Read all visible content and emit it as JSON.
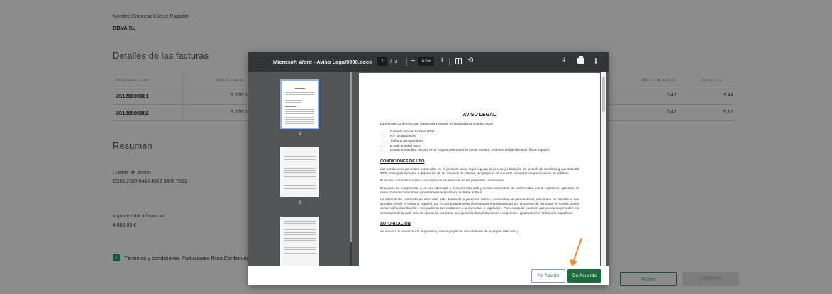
{
  "background": {
    "company_label": "Nombre Empresa Cliente Pagador",
    "company_value": "BBVA SL",
    "invoices_title": "Detalles de las facturas",
    "table": {
      "headers": [
        "Nº DE FACTURA",
        "IMP. A FINANC",
        "IMP. COB. GTOS",
        "TOTAL LIQ."
      ],
      "rows": [
        {
          "invoice": "JS120000001",
          "amount": "2.000,0",
          "fees": "0,42",
          "total": "3,44"
        },
        {
          "invoice": "JS120000002",
          "amount": "2.000,0",
          "fees": "0,42",
          "total": "5,16"
        }
      ]
    },
    "summary_title": "Resumen",
    "account_label": "Cuenta de abono",
    "account_value": "ES66 2100 0418 4012 3456 7891",
    "total_label": "Importe total a financiar",
    "total_value": "4.000,00 €",
    "terms_label": "Términos y condiciones Particulares RuralConfirming",
    "back_button": "Volver",
    "confirm_button": "Confirmar"
  },
  "viewer": {
    "title": "Microsoft Word - Aviso Legal9000.docx",
    "current_page": "1",
    "page_separator": "/",
    "total_pages": "3",
    "zoom": "83%",
    "thumb_labels": [
      "1",
      "2"
    ]
  },
  "document": {
    "title": "AVISO LEGAL",
    "intro": "La Web de Confirming que usted está visitando es titularidad de Entidad 9000",
    "bullets": [
      "Domicilio Social: Entidad 9000",
      "NIF: Entidad 9000",
      "Teléfono: Entidad 9000",
      "E-mail: Entidad 9000",
      "Datos mercantiles: Inscrita en el Registro Mercantil de            con el número           . Número de identificación fiscal español"
    ],
    "section1_title": "CONDICIONES DE USO",
    "section1_paragraphs": [
      "Las condiciones generales contenidas en el presente aviso legal regulan el acceso y utilización de la Web de Confirming que Entidad 9000 pone gratuitamente a disposición de los usuarios de Internet, sin perjuicio de que esto circunstancia pueda variar en el futuro.",
      "El acceso a la misma implica la aceptación sin reservas de las presentes condiciones.",
      "El usuario se compromete a un uso adecuado y lícito del sitio web y de los contenidos, de conformidad con la legislación aplicable, la moral, buenas costumbres generalmente aceptadas y el orden público.",
      "La información contenida en esta Web está destinada a personas físicas y entidades en personalidad, residentes en España o que accedan desde el territorio español, por lo que Entidad 9000 declina toda responsabilidad por el acceso de personas en jurisdicciones donde dicha distribución o uso pudieran ser contrarios a la normativa o regulación. Para cualquier cuestión que pueda surgir sobre los contenidos de la web, será de aplicación por tanto, la Legislación Española siendo competentes igualmente los Tribunales Españoles."
    ],
    "section2_title": "AUTORIZACIÓN",
    "section2_paragraph": "Se autoriza la visualización, impresión y descarga parcial del contenido de la página Web sólo y"
  },
  "footer": {
    "reject_label": "No Acepto",
    "accept_label": "De Acuerdo"
  },
  "colors": {
    "accent_green": "#1c6b3a",
    "toolbar": "#323639",
    "annotation_arrow": "#f08a24"
  }
}
